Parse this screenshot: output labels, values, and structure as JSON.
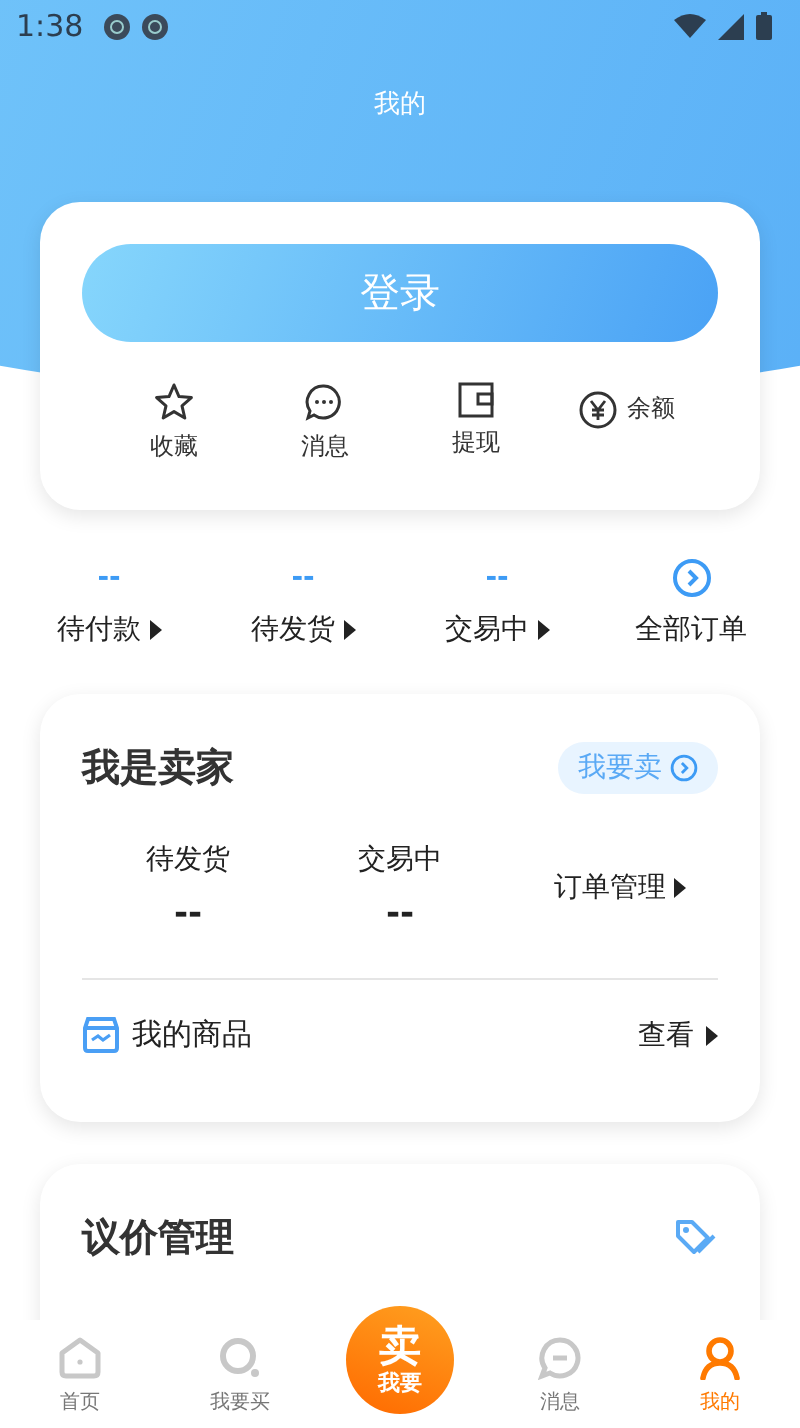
{
  "status_bar": {
    "time": "1:38"
  },
  "header": {
    "title": "我的"
  },
  "account_card": {
    "login_button": "登录",
    "shortcuts": [
      {
        "kind": "star",
        "label": "收藏"
      },
      {
        "kind": "chat",
        "label": "消息"
      },
      {
        "kind": "wallet",
        "label": "提现"
      },
      {
        "kind": "yuan",
        "label": "余额"
      }
    ]
  },
  "orders": [
    {
      "kind": "count",
      "count": "--",
      "label": "待付款"
    },
    {
      "kind": "count",
      "count": "--",
      "label": "待发货"
    },
    {
      "kind": "count",
      "count": "--",
      "label": "交易中"
    },
    {
      "kind": "all",
      "label": "全部订单"
    }
  ],
  "seller_card": {
    "title": "我是卖家",
    "sell_button": "我要卖",
    "stats": [
      {
        "label": "待发货",
        "count": "--"
      },
      {
        "label": "交易中",
        "count": "--"
      }
    ],
    "manage_link": "订单管理",
    "goods_label": "我的商品",
    "view_link": "查看"
  },
  "bargain_card": {
    "title": "议价管理"
  },
  "tab_bar": {
    "tabs": [
      {
        "kind": "home",
        "label": "首页",
        "selected": false
      },
      {
        "kind": "search",
        "label": "我要买",
        "selected": false
      },
      {
        "kind": "sell",
        "big": "卖",
        "small": "我要"
      },
      {
        "kind": "chat",
        "label": "消息",
        "selected": false
      },
      {
        "kind": "user",
        "label": "我的",
        "selected": true
      }
    ]
  }
}
